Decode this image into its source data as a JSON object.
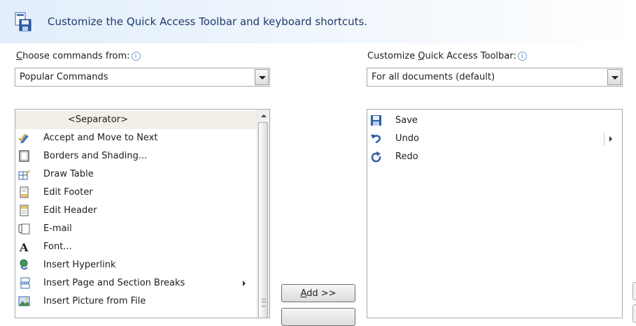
{
  "header": {
    "title": "Customize the Quick Access Toolbar and keyboard shortcuts."
  },
  "choose": {
    "label_ul": "C",
    "label_rest": "hoose commands from:",
    "info": "i",
    "value": "Popular Commands"
  },
  "customize": {
    "label_pre": "Customize ",
    "label_ul": "Q",
    "label_rest": "uick Access Toolbar:",
    "info": "i",
    "value": "For all documents (default)"
  },
  "commands": {
    "separator": "<Separator>",
    "items": [
      {
        "label": "Accept and Move to Next",
        "icon": "accept-check-icon"
      },
      {
        "label": "Borders and Shading...",
        "icon": "borders-icon"
      },
      {
        "label": "Draw Table",
        "icon": "draw-table-icon"
      },
      {
        "label": "Edit Footer",
        "icon": "footer-icon"
      },
      {
        "label": "Edit Header",
        "icon": "header-icon"
      },
      {
        "label": "E-mail",
        "icon": "email-icon"
      },
      {
        "label": "Font...",
        "icon": "font-icon"
      },
      {
        "label": "Insert Hyperlink",
        "icon": "hyperlink-globe-icon"
      },
      {
        "label": "Insert Page and Section Breaks",
        "icon": "page-break-icon"
      },
      {
        "label": "Insert Picture from File",
        "icon": "picture-icon"
      }
    ]
  },
  "toolbar": {
    "items": [
      {
        "label": "Save",
        "icon": "save-disk-icon"
      },
      {
        "label": "Undo",
        "icon": "undo-arrow-icon"
      },
      {
        "label": "Redo",
        "icon": "redo-arrow-icon"
      }
    ]
  },
  "buttons": {
    "add_ul": "A",
    "add_rest": "dd >>"
  },
  "colors": {
    "accent": "#1f3a6b",
    "banner_start": "#e2eefb",
    "selection": "#f1efe6"
  }
}
